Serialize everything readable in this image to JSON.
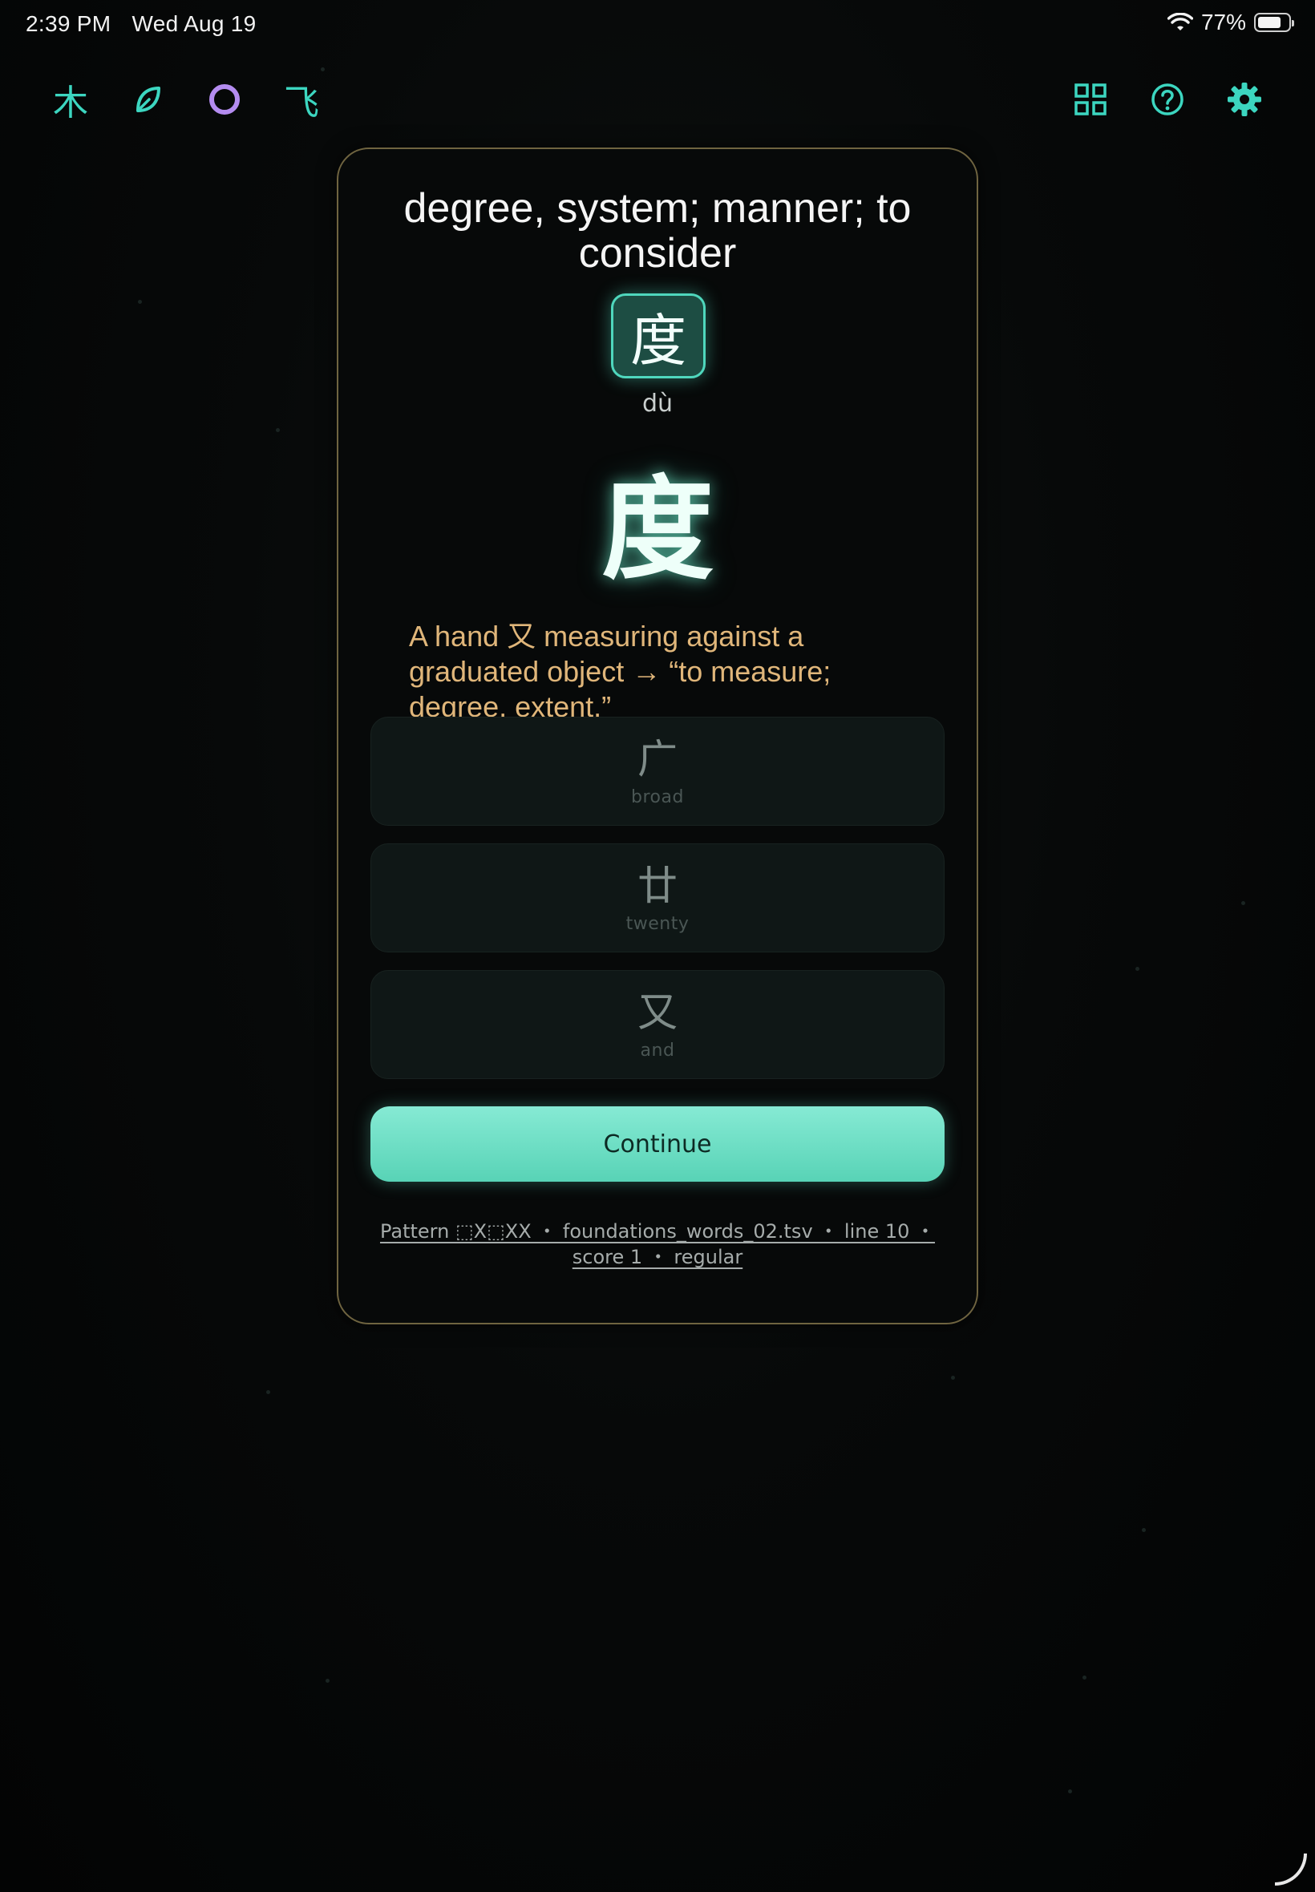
{
  "status_bar": {
    "time": "2:39 PM",
    "date": "Wed Aug 19",
    "battery": "77%",
    "battery_level": 0.77
  },
  "toolbar": {
    "left_icons": [
      {
        "name": "tree-icon",
        "glyph": "木"
      },
      {
        "name": "leaf-icon",
        "glyph": "⌀"
      },
      {
        "name": "circle-icon",
        "glyph": "○"
      },
      {
        "name": "fly-icon",
        "glyph": "飞"
      }
    ],
    "right_icons": [
      {
        "name": "grid-icon",
        "glyph": "▦"
      },
      {
        "name": "help-icon",
        "glyph": "?"
      },
      {
        "name": "gear-icon",
        "glyph": "⚙"
      }
    ],
    "accent_color": "#3cd6c0",
    "active_color": "#b48cf0"
  },
  "card": {
    "title": "degree, system; manner; to consider",
    "character_small": "度",
    "pinyin": "dù",
    "character_large": "度",
    "explanation": "A hand 又 measuring against a graduated object → “to measure; degree, extent.”",
    "options": [
      {
        "char": "广",
        "gloss": "broad"
      },
      {
        "char": "廿",
        "gloss": "twenty"
      },
      {
        "char": "又",
        "gloss": "and"
      }
    ],
    "continue_label": "Continue",
    "meta_line1": "Pattern ⬚X⬚XX ・ foundations_words_02.tsv ・ line 10 ・",
    "meta_line2": "score 1 ・ regular",
    "border_color": "#6f6440",
    "explanation_color": "#e0b67a"
  }
}
